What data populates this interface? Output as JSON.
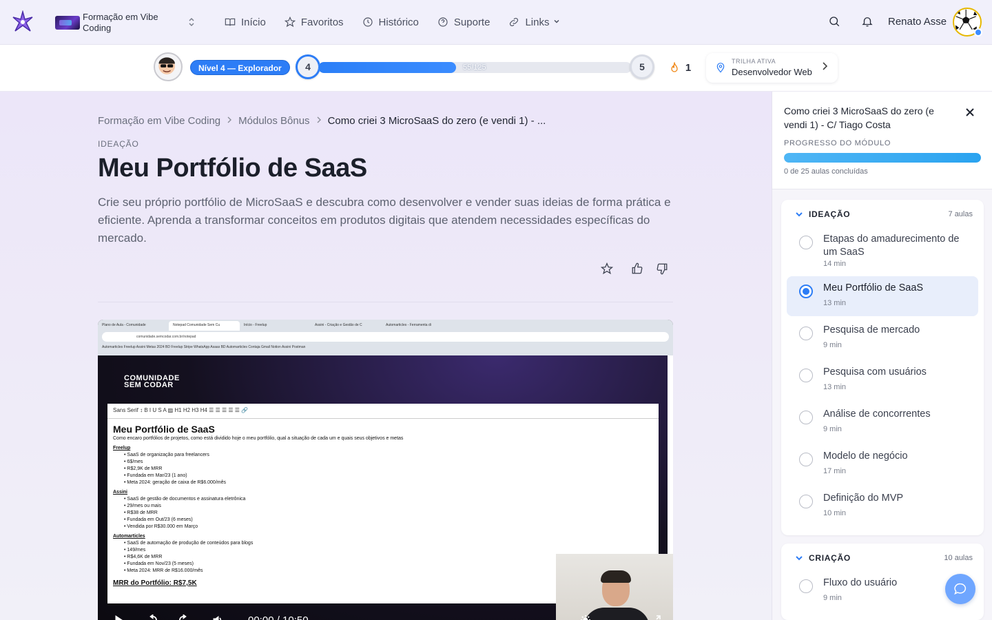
{
  "nav": {
    "course_name": "Formação em Vibe Coding",
    "links": [
      {
        "label": "Início",
        "icon": "book-icon"
      },
      {
        "label": "Favoritos",
        "icon": "star-icon"
      },
      {
        "label": "Histórico",
        "icon": "clock-icon"
      },
      {
        "label": "Suporte",
        "icon": "help-circle-icon"
      },
      {
        "label": "Links",
        "icon": "link-icon"
      }
    ],
    "user_name": "Renato Asse"
  },
  "progress": {
    "level_badge": "Nível 4 — Explorador",
    "level_current": "4",
    "level_next": "5",
    "xp_text": "55/125",
    "xp_fraction": 0.44,
    "streak": "1",
    "trail_kicker": "TRILHA ATIVA",
    "trail_name": "Desenvolvedor Web"
  },
  "main": {
    "breadcrumb": [
      "Formação em Vibe Coding",
      "Módulos Bônus",
      "Como criei 3 MicroSaaS do zero (e vendi 1) - ..."
    ],
    "kicker": "IDEAÇÃO",
    "title": "Meu Portfólio de SaaS",
    "description": "Crie seu próprio portfólio de MicroSaaS e descubra como desenvolver e vender suas ideias de forma prática e eficiente. Aprenda a transformar conceitos em produtos digitais que atendem necessidades específicas do mercado."
  },
  "video": {
    "tabs": [
      "Plano de Aula - Comunidade",
      "Notepad Comunidade Sem Cu",
      "Início - Freelup",
      "Assini - Criação e Gestão de C",
      "Automarticles - Ferramenta di"
    ],
    "address": "comunidade.semcodar.com.br/notepad",
    "bookmarks": "Automarticles   Freelup   Assini   Metas 2024   BD Freelup   Stripe   WhatsApp   Asaas   BD Automarticles   Contaja   Gmail   Notion Assini   Postman",
    "logo_line1": "COMUNIDADE",
    "logo_line2": "SEM CODAR",
    "doc_toolbar": "Sans Serif   ↕   B  I  U  S    A  ▨    H1  H2  H3  H4    ☰  ☰    ☰  ☰  ☰  🔗",
    "doc_title": "Meu Portfólio de SaaS",
    "doc_intro": "Como encaro portfólios de projetos, como está dividido hoje o meu portfólio, qual a situação de cada um e quais seus objetivos e metas",
    "doc_sections": [
      {
        "name": "Freelup",
        "items": [
          "SaaS de organização para freelancers",
          "6$/mes",
          "R$2,9K de MRR",
          "Fundada em Mar/23 (1 ano)",
          "Meta 2024: geração de caixa de R$6.000/mês"
        ]
      },
      {
        "name": "Assini",
        "items": [
          "SaaS de gestão de documentos e assinatura eletrônica",
          "29/mes ou mais",
          "R$38 de MRR",
          "Fundada em Out/23 (6 meses)",
          "Vendida por R$30.000 em Março"
        ]
      },
      {
        "name": "Automarticles",
        "items": [
          "SaaS de automação de produção de conteúdos para blogs",
          "149/mes",
          "R$4,6K de MRR",
          "Fundada em Nov/23 (5 meses)",
          "Meta 2024: MRR de R$16.000/mês"
        ]
      }
    ],
    "doc_mrr": "MRR do Portfólio: R$7,5K",
    "time": "00:00 / 10:50"
  },
  "sidebar": {
    "title": "Como criei 3 MicroSaaS do zero (e vendi 1) - C/ Tiago Costa",
    "kicker": "PROGRESSO DO MÓDULO",
    "progress_fraction": 0.0,
    "count": "0 de 25 aulas concluídas",
    "sections": [
      {
        "name": "IDEAÇÃO",
        "count": "7 aulas",
        "lessons": [
          {
            "name": "Etapas do amadurecimento de um SaaS",
            "dur": "14 min"
          },
          {
            "name": "Meu Portfólio de SaaS",
            "dur": "13 min",
            "active": true
          },
          {
            "name": "Pesquisa de mercado",
            "dur": "9 min"
          },
          {
            "name": "Pesquisa com usuários",
            "dur": "13 min"
          },
          {
            "name": "Análise de concorrentes",
            "dur": "9 min"
          },
          {
            "name": "Modelo de negócio",
            "dur": "17 min"
          },
          {
            "name": "Definição do MVP",
            "dur": "10 min"
          }
        ]
      },
      {
        "name": "CRIAÇÃO",
        "count": "10 aulas",
        "lessons": [
          {
            "name": "Fluxo do usuário",
            "dur": "9 min"
          }
        ]
      }
    ]
  },
  "colors": {
    "accent": "#2d7df6",
    "module_progress": "#2aa3f0"
  }
}
